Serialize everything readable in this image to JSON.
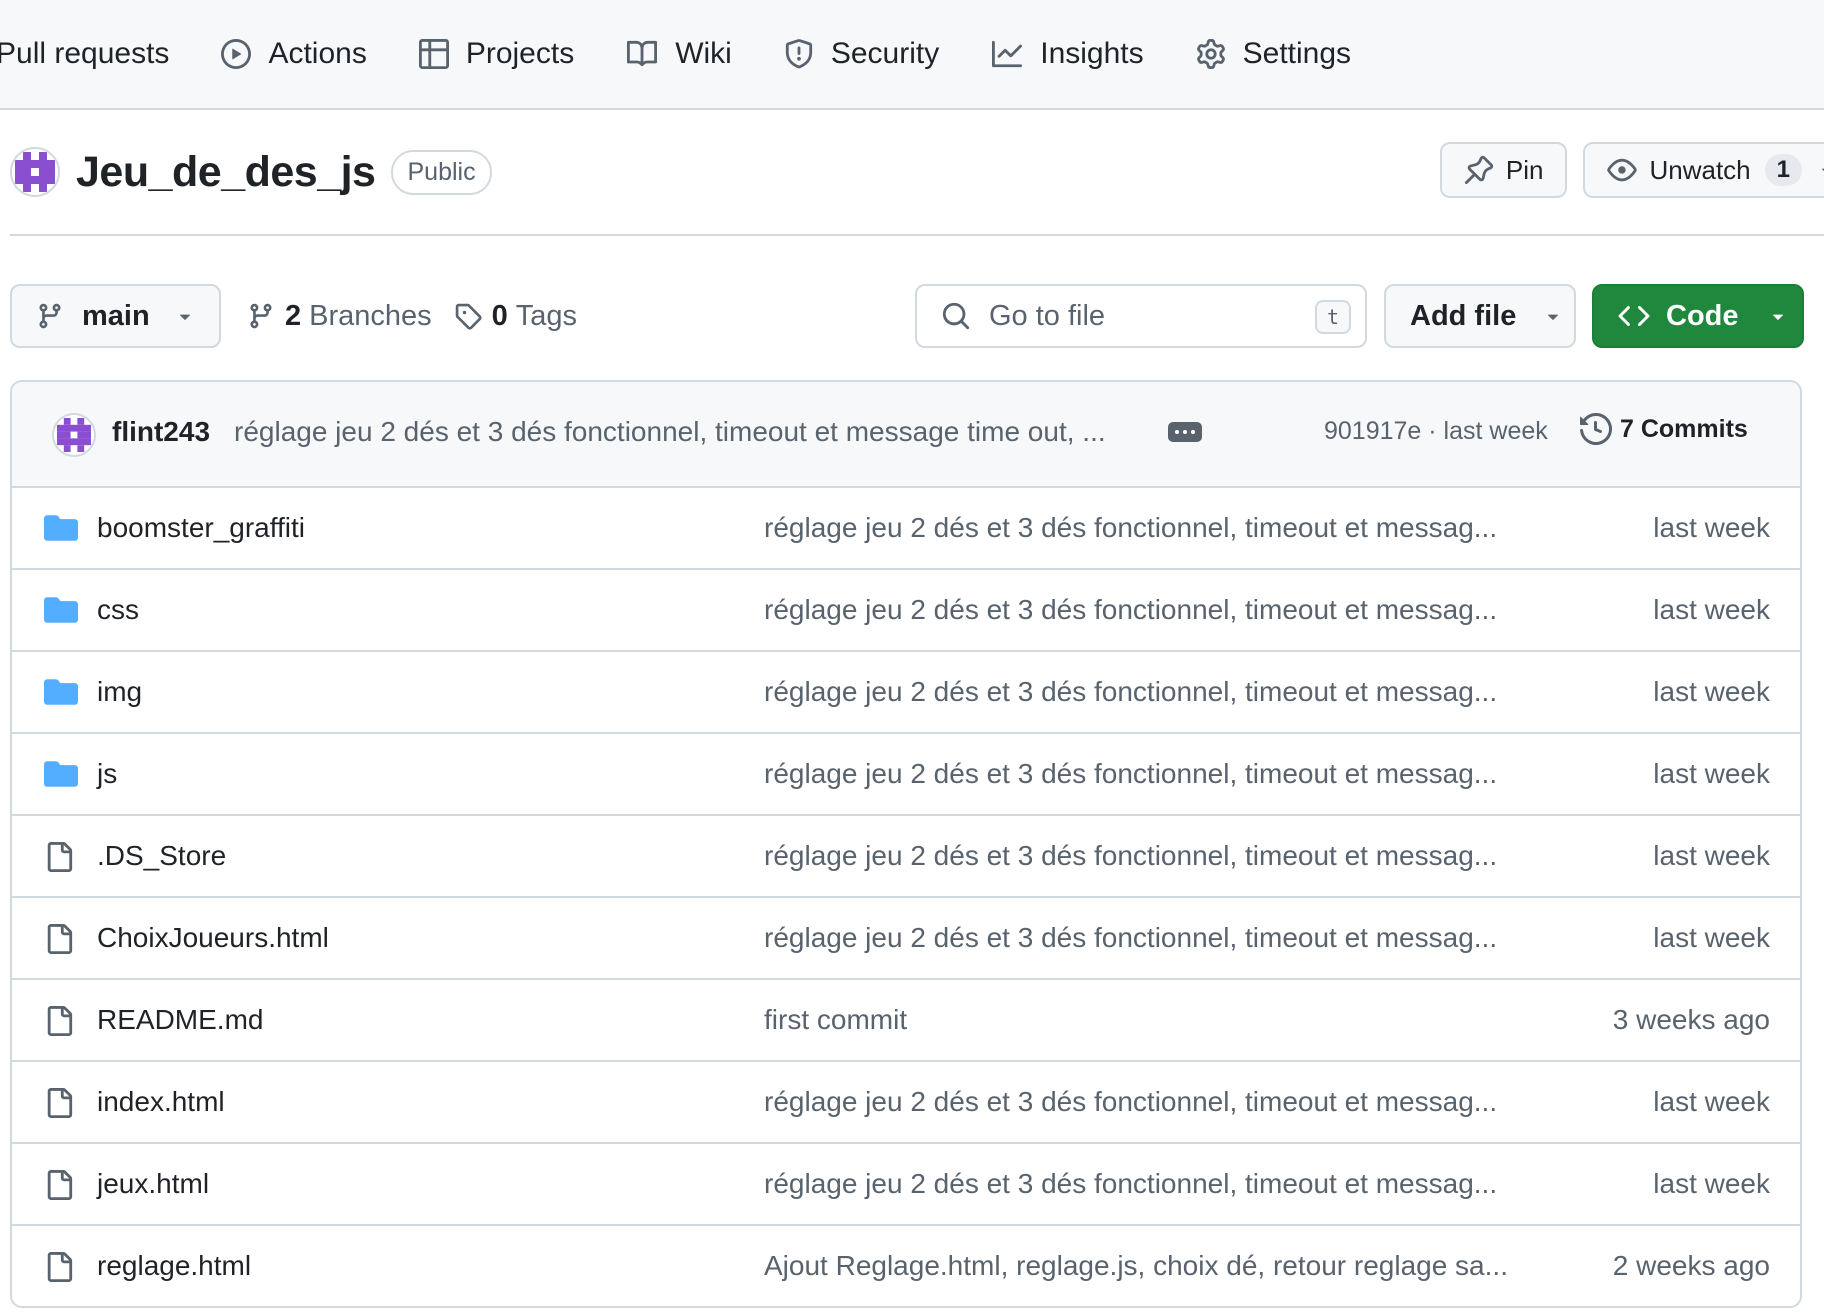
{
  "nav": {
    "items": [
      {
        "label": "Pull requests",
        "icon": "pull-request-icon"
      },
      {
        "label": "Actions",
        "icon": "play-icon"
      },
      {
        "label": "Projects",
        "icon": "table-icon"
      },
      {
        "label": "Wiki",
        "icon": "book-icon"
      },
      {
        "label": "Security",
        "icon": "shield-icon"
      },
      {
        "label": "Insights",
        "icon": "graph-icon"
      },
      {
        "label": "Settings",
        "icon": "gear-icon"
      }
    ]
  },
  "repo": {
    "name": "Jeu_de_des_js",
    "visibility": "Public",
    "pin_label": "Pin",
    "watch_label": "Unwatch",
    "watch_count": "1"
  },
  "file_nav": {
    "branch": "main",
    "branches_count": "2",
    "branches_label": "Branches",
    "tags_count": "0",
    "tags_label": "Tags",
    "goto_placeholder": "Go to file",
    "goto_shortcut": "t",
    "add_file_label": "Add file",
    "code_label": "Code"
  },
  "latest_commit": {
    "author": "flint243",
    "message": "réglage jeu 2 dés et 3 dés fonctionnel, timeout et message time out, ...",
    "sha_age": "901917e · last week",
    "commits_label": "7 Commits"
  },
  "files": [
    {
      "name": "boomster_graffiti",
      "type": "folder",
      "message": "réglage jeu 2 dés et 3 dés fonctionnel, timeout et messag...",
      "age": "last week"
    },
    {
      "name": "css",
      "type": "folder",
      "message": "réglage jeu 2 dés et 3 dés fonctionnel, timeout et messag...",
      "age": "last week"
    },
    {
      "name": "img",
      "type": "folder",
      "message": "réglage jeu 2 dés et 3 dés fonctionnel, timeout et messag...",
      "age": "last week"
    },
    {
      "name": "js",
      "type": "folder",
      "message": "réglage jeu 2 dés et 3 dés fonctionnel, timeout et messag...",
      "age": "last week"
    },
    {
      "name": ".DS_Store",
      "type": "file",
      "message": "réglage jeu 2 dés et 3 dés fonctionnel, timeout et messag...",
      "age": "last week"
    },
    {
      "name": "ChoixJoueurs.html",
      "type": "file",
      "message": "réglage jeu 2 dés et 3 dés fonctionnel, timeout et messag...",
      "age": "last week"
    },
    {
      "name": "README.md",
      "type": "file",
      "message": "first commit",
      "age": "3 weeks ago"
    },
    {
      "name": "index.html",
      "type": "file",
      "message": "réglage jeu 2 dés et 3 dés fonctionnel, timeout et messag...",
      "age": "last week"
    },
    {
      "name": "jeux.html",
      "type": "file",
      "message": "réglage jeu 2 dés et 3 dés fonctionnel, timeout et messag...",
      "age": "last week"
    },
    {
      "name": "reglage.html",
      "type": "file",
      "message": "Ajout Reglage.html, reglage.js, choix dé, retour reglage sa...",
      "age": "2 weeks ago"
    }
  ],
  "colors": {
    "accent_green": "#1f883d",
    "folder_blue": "#54aeff",
    "muted_text": "#59636e",
    "border": "#d1d9e0",
    "avatar_purple": "#8a4fd1"
  }
}
